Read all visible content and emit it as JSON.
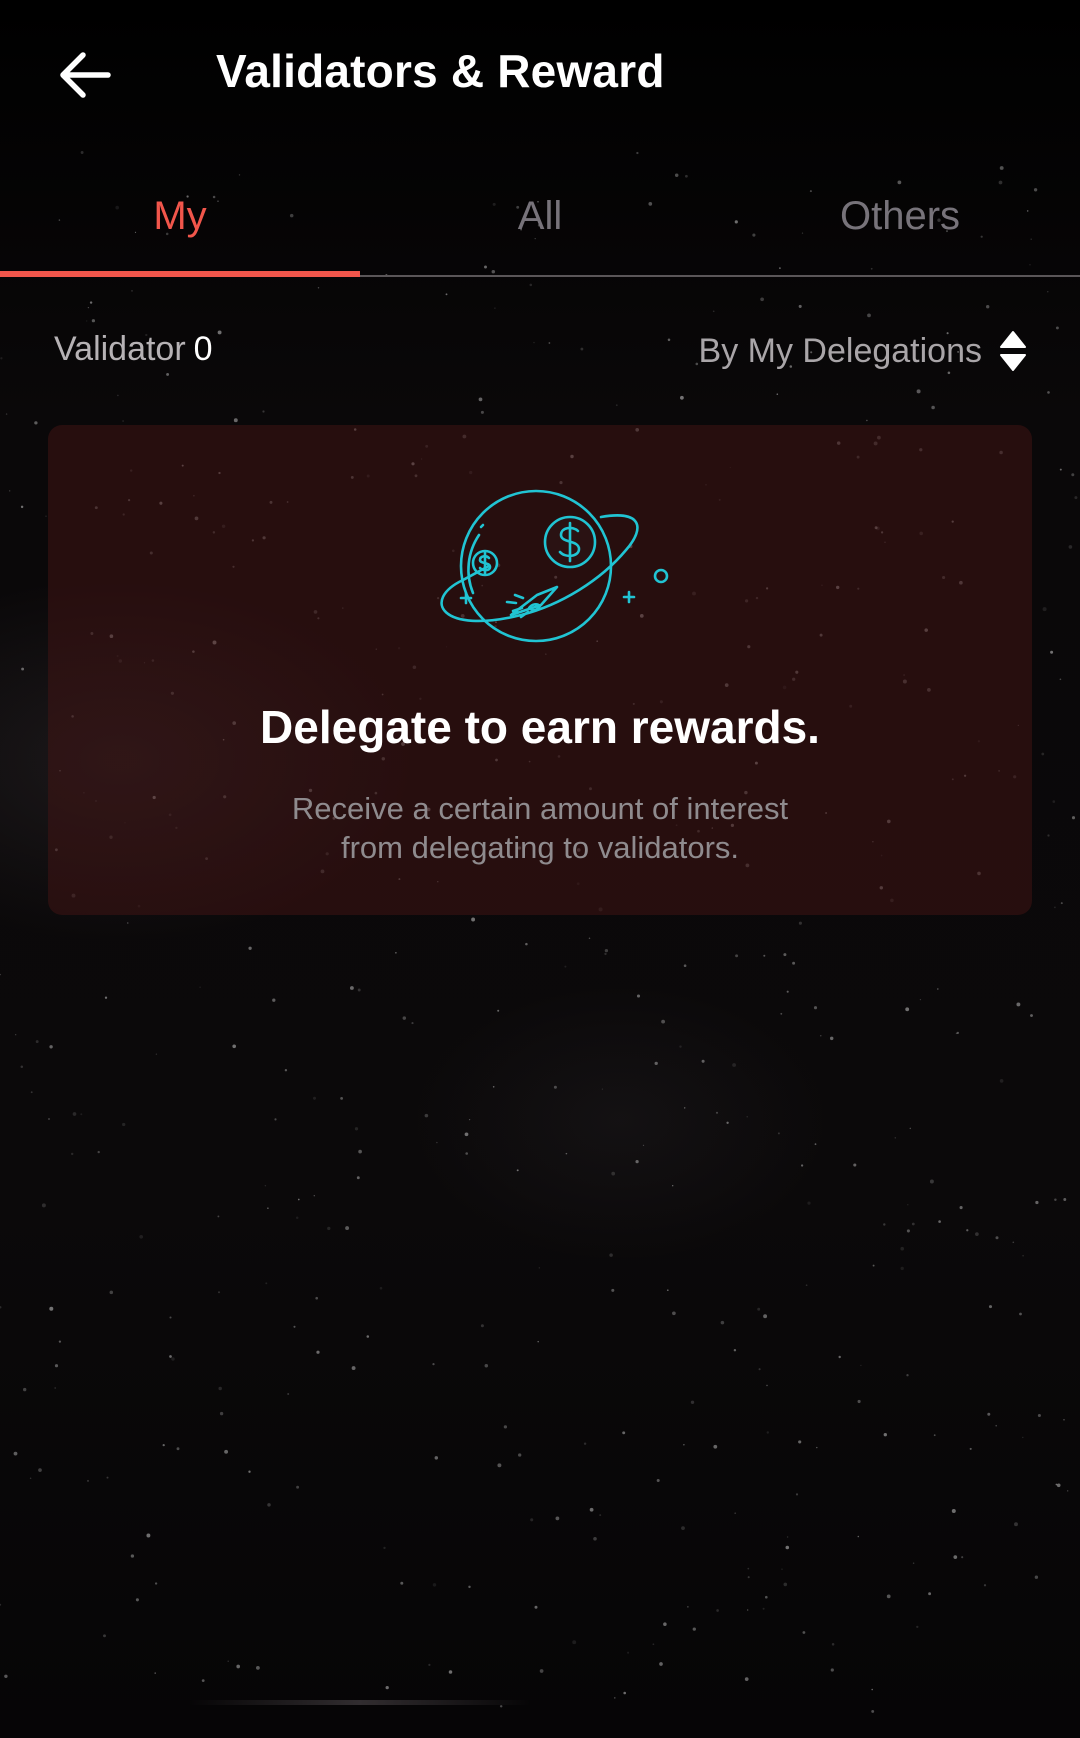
{
  "colors": {
    "accent": "#f1564b",
    "tab_inactive": "#77737a",
    "card_bg": "#3a1414",
    "illustration": "#21c4d3"
  },
  "header": {
    "back_icon": "arrow-left-icon",
    "title": "Validators & Reward"
  },
  "tabs": [
    {
      "label": "My",
      "active": true
    },
    {
      "label": "All",
      "active": false
    },
    {
      "label": "Others",
      "active": false
    }
  ],
  "filter": {
    "count_label": "Validator",
    "count_value": "0",
    "sort_label": "By My Delegations",
    "sort_icon": "sort-up-down-icon"
  },
  "empty_state": {
    "illustration_icon": "planet-rocket-dollar-icon",
    "title": "Delegate to earn rewards.",
    "description_line1": "Receive a certain amount of interest",
    "description_line2": "from delegating to validators."
  }
}
